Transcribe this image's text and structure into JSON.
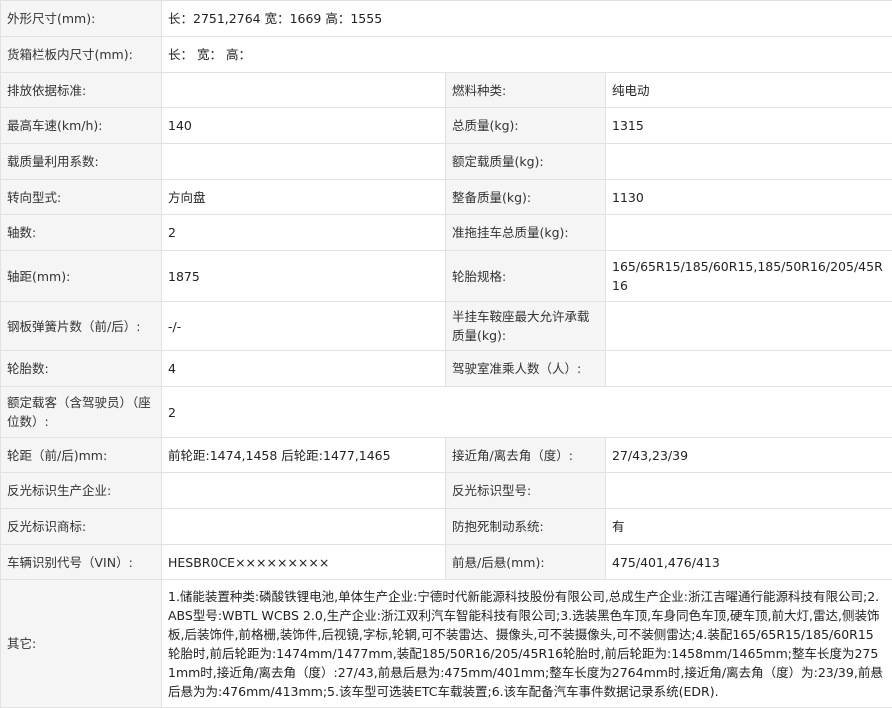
{
  "rows": [
    {
      "l1": "外形尺寸(mm):",
      "v1": "长：2751,2764 宽：1669 高：1555"
    },
    {
      "l1": "货箱栏板内尺寸(mm):",
      "v1": "长：  宽：  高："
    },
    {
      "l1": "排放依据标准:",
      "v1": "",
      "l2": "燃料种类:",
      "v2": "纯电动"
    },
    {
      "l1": "最高车速(km/h):",
      "v1": "140",
      "l2": "总质量(kg):",
      "v2": "1315"
    },
    {
      "l1": "载质量利用系数:",
      "v1": "",
      "l2": "额定载质量(kg):",
      "v2": ""
    },
    {
      "l1": "转向型式:",
      "v1": "方向盘",
      "l2": "整备质量(kg):",
      "v2": "1130"
    },
    {
      "l1": "轴数:",
      "v1": "2",
      "l2": "准拖挂车总质量(kg):",
      "v2": ""
    },
    {
      "l1": "轴距(mm):",
      "v1": "1875",
      "l2": "轮胎规格:",
      "v2": "165/65R15/185/60R15,185/50R16/205/45R16"
    },
    {
      "l1": "钢板弹簧片数（前/后）:",
      "v1": "-/-",
      "l2": "半挂车鞍座最大允许承载质量(kg):",
      "v2": ""
    },
    {
      "l1": "轮胎数:",
      "v1": "4",
      "l2": "驾驶室准乘人数（人）:",
      "v2": ""
    },
    {
      "l1": "额定载客（含驾驶员）（座位数）:",
      "v1": "2"
    },
    {
      "l1": "轮距（前/后)mm:",
      "v1": "前轮距:1474,1458 后轮距:1477,1465",
      "l2": "接近角/离去角（度）:",
      "v2": "27/43,23/39"
    },
    {
      "l1": "反光标识生产企业:",
      "v1": "",
      "l2": "反光标识型号:",
      "v2": ""
    },
    {
      "l1": "反光标识商标:",
      "v1": "",
      "l2": "防抱死制动系统:",
      "v2": "有"
    },
    {
      "l1": "车辆识别代号（VIN）:",
      "v1": "HESBR0CE×××××××××",
      "l2": "前悬/后悬(mm):",
      "v2": "475/401,476/413"
    },
    {
      "l1": "其它:",
      "v1": "1.储能装置种类:磷酸铁锂电池,单体生产企业:宁德时代新能源科技股份有限公司,总成生产企业:浙江吉曜通行能源科技有限公司;2.ABS型号:WBTL WCBS 2.0,生产企业:浙江双利汽车智能科技有限公司;3.选装黑色车顶,车身同色车顶,硬车顶,前大灯,雷达,侧装饰板,后装饰件,前格栅,装饰件,后视镜,字标,轮辋,可不装雷达、摄像头,可不装摄像头,可不装侧雷达;4.装配165/65R15/185/60R15轮胎时,前后轮距为:1474mm/1477mm,装配185/50R16/205/45R16轮胎时,前后轮距为:1458mm/1465mm;整车长度为2751mm时,接近角/离去角（度）:27/43,前悬后悬为:475mm/401mm;整车长度为2764mm时,接近角/离去角（度）为:23/39,前悬后悬为为:476mm/413mm;5.该车型可选装ETC车载装置;6.该车配备汽车事件数据记录系统(EDR)."
    }
  ]
}
